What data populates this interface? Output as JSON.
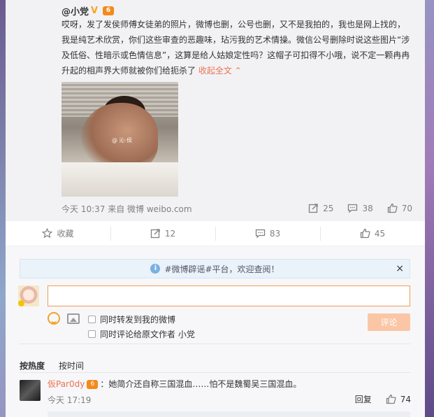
{
  "original_post": {
    "author_name": "@小党",
    "verified_icon": "v-badge-icon",
    "level_icon": "level-badge-icon",
    "body_text": "哎呀，发了发侯师傅女徒弟的照片，微博也删，公号也删，又不是我拍的，我也是网上找的，我是纯艺术欣赏，你们这些审查的恶趣味，玷污我的艺术情操。微信公号删除时说这些图片“涉及低俗、性暗示或色情信息”，这算是给人姑娘定性吗？这帽子可扣得不小哦，说不定一颗冉冉升起的相声界大师就被你们给扼杀了 ",
    "collapse_label": "收起全文",
    "image_watermark": "@ 沁·侯",
    "time": "今天 10:37",
    "source": "来自 微博 weibo.com",
    "reposts": "25",
    "comments": "38",
    "likes": "70"
  },
  "actions": {
    "favorite_label": "收藏",
    "repost_count": "12",
    "comment_count": "83",
    "like_count": "45"
  },
  "comment_area": {
    "notice_text": "#微博辟谣#平台，欢迎查阅！",
    "notice_close": "×",
    "repost_check_label": "同时转发到我的微博",
    "comment_orig_check_label": "同时评论给原文作者 小党",
    "submit_label": "评论",
    "sort_hot": "按热度",
    "sort_time": "按时间"
  },
  "comments": [
    {
      "user": "仮Par0dy",
      "text": "：她简介还自称三国混血……怕不是魏蜀吴三国混血。",
      "time": "今天 17:19",
      "reply_label": "回复",
      "likes": "74"
    }
  ],
  "colors": {
    "accent": "#eb7350",
    "submit_bg": "#fbc6a5",
    "input_border": "#f39b55"
  }
}
